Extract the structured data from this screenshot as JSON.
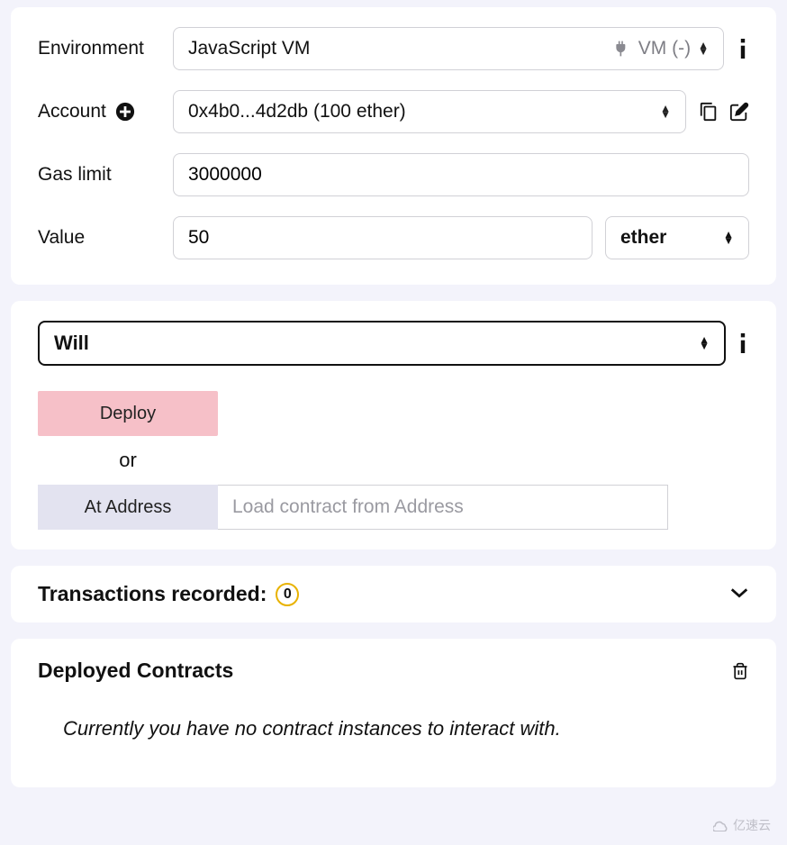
{
  "settings": {
    "environment": {
      "label": "Environment",
      "value": "JavaScript VM",
      "status": "VM (-)"
    },
    "account": {
      "label": "Account",
      "value": "0x4b0...4d2db (100 ether)"
    },
    "gas_limit": {
      "label": "Gas limit",
      "value": "3000000"
    },
    "value": {
      "label": "Value",
      "amount": "50",
      "unit": "ether"
    }
  },
  "contract": {
    "selected": "Will",
    "deploy_label": "Deploy",
    "or_label": "or",
    "at_address_label": "At Address",
    "load_placeholder": "Load contract from Address"
  },
  "transactions": {
    "title": "Transactions recorded:",
    "count": "0"
  },
  "deployed": {
    "title": "Deployed Contracts",
    "empty": "Currently you have no contract instances to interact with."
  },
  "watermark": "亿速云"
}
